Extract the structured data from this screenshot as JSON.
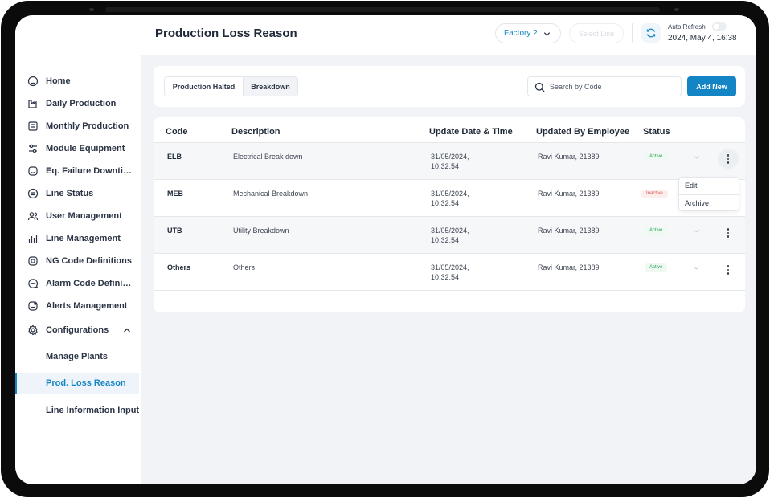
{
  "header": {
    "title": "Production Loss Reason",
    "factory": "Factory 2",
    "line_placeholder": "Select Line",
    "auto_refresh_label": "Auto Refresh",
    "datetime": "2024, May 4, 16:38"
  },
  "sidebar": {
    "items": [
      {
        "label": "Home",
        "icon": "home-icon"
      },
      {
        "label": "Daily Production",
        "icon": "factory-icon"
      },
      {
        "label": "Monthly Production",
        "icon": "calendar-icon"
      },
      {
        "label": "Module Equipment",
        "icon": "sliders-icon"
      },
      {
        "label": "Eq. Failure Downtime",
        "icon": "alert-face-icon"
      },
      {
        "label": "Line Status",
        "icon": "list-icon"
      },
      {
        "label": "User Management",
        "icon": "users-icon"
      },
      {
        "label": "Line Management",
        "icon": "bar-chart-icon"
      },
      {
        "label": "NG Code Definitions",
        "icon": "chip-icon"
      },
      {
        "label": "Alarm Code Definiti...",
        "icon": "chat-dots-icon"
      },
      {
        "label": "Alerts Management",
        "icon": "alert-box-icon"
      },
      {
        "label": "Configurations",
        "icon": "gear-icon"
      }
    ],
    "sub_items": [
      {
        "label": "Manage Plants"
      },
      {
        "label": "Prod. Loss Reason"
      },
      {
        "label": "Line Information Input"
      }
    ]
  },
  "toolbar": {
    "tabs": [
      "Production Halted",
      "Breakdown"
    ],
    "search_placeholder": "Search by Code",
    "add_label": "Add New"
  },
  "table": {
    "columns": [
      "Code",
      "Description",
      "Update Date & Time",
      "Updated By Employee",
      "Status"
    ],
    "rows": [
      {
        "code": "ELB",
        "description": "Electrical Break down",
        "date": "31/05/2024,",
        "time": "10:32:54",
        "employee": "Ravi Kumar, 21389",
        "status": "Active"
      },
      {
        "code": "MEB",
        "description": "Mechanical Breakdown",
        "date": "31/05/2024,",
        "time": "10:32:54",
        "employee": "Ravi Kumar, 21389",
        "status": "Inactive"
      },
      {
        "code": "UTB",
        "description": "Utility Breakdown",
        "date": "31/05/2024,",
        "time": "10:32:54",
        "employee": "Ravi Kumar, 21389",
        "status": "Active"
      },
      {
        "code": "Others",
        "description": "Others",
        "date": "31/05/2024,",
        "time": "10:32:54",
        "employee": "Ravi Kumar, 21389",
        "status": "Active"
      }
    ]
  },
  "row_menu": {
    "items": [
      "Edit",
      "Archive"
    ]
  },
  "colors": {
    "accent": "#1485c4",
    "active_status": "#2fa05a",
    "inactive_status": "#d9534f"
  }
}
